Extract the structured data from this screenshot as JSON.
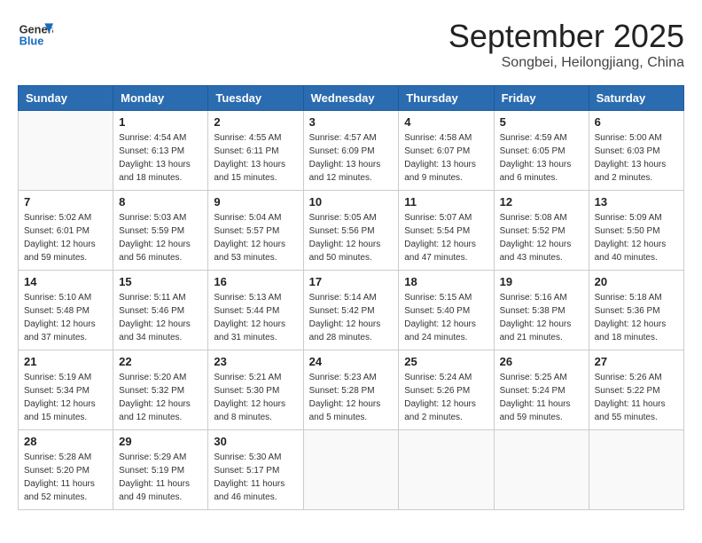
{
  "header": {
    "logo_general": "General",
    "logo_blue": "Blue",
    "month": "September 2025",
    "location": "Songbei, Heilongjiang, China"
  },
  "weekdays": [
    "Sunday",
    "Monday",
    "Tuesday",
    "Wednesday",
    "Thursday",
    "Friday",
    "Saturday"
  ],
  "weeks": [
    [
      {
        "day": "",
        "info": ""
      },
      {
        "day": "1",
        "info": "Sunrise: 4:54 AM\nSunset: 6:13 PM\nDaylight: 13 hours\nand 18 minutes."
      },
      {
        "day": "2",
        "info": "Sunrise: 4:55 AM\nSunset: 6:11 PM\nDaylight: 13 hours\nand 15 minutes."
      },
      {
        "day": "3",
        "info": "Sunrise: 4:57 AM\nSunset: 6:09 PM\nDaylight: 13 hours\nand 12 minutes."
      },
      {
        "day": "4",
        "info": "Sunrise: 4:58 AM\nSunset: 6:07 PM\nDaylight: 13 hours\nand 9 minutes."
      },
      {
        "day": "5",
        "info": "Sunrise: 4:59 AM\nSunset: 6:05 PM\nDaylight: 13 hours\nand 6 minutes."
      },
      {
        "day": "6",
        "info": "Sunrise: 5:00 AM\nSunset: 6:03 PM\nDaylight: 13 hours\nand 2 minutes."
      }
    ],
    [
      {
        "day": "7",
        "info": "Sunrise: 5:02 AM\nSunset: 6:01 PM\nDaylight: 12 hours\nand 59 minutes."
      },
      {
        "day": "8",
        "info": "Sunrise: 5:03 AM\nSunset: 5:59 PM\nDaylight: 12 hours\nand 56 minutes."
      },
      {
        "day": "9",
        "info": "Sunrise: 5:04 AM\nSunset: 5:57 PM\nDaylight: 12 hours\nand 53 minutes."
      },
      {
        "day": "10",
        "info": "Sunrise: 5:05 AM\nSunset: 5:56 PM\nDaylight: 12 hours\nand 50 minutes."
      },
      {
        "day": "11",
        "info": "Sunrise: 5:07 AM\nSunset: 5:54 PM\nDaylight: 12 hours\nand 47 minutes."
      },
      {
        "day": "12",
        "info": "Sunrise: 5:08 AM\nSunset: 5:52 PM\nDaylight: 12 hours\nand 43 minutes."
      },
      {
        "day": "13",
        "info": "Sunrise: 5:09 AM\nSunset: 5:50 PM\nDaylight: 12 hours\nand 40 minutes."
      }
    ],
    [
      {
        "day": "14",
        "info": "Sunrise: 5:10 AM\nSunset: 5:48 PM\nDaylight: 12 hours\nand 37 minutes."
      },
      {
        "day": "15",
        "info": "Sunrise: 5:11 AM\nSunset: 5:46 PM\nDaylight: 12 hours\nand 34 minutes."
      },
      {
        "day": "16",
        "info": "Sunrise: 5:13 AM\nSunset: 5:44 PM\nDaylight: 12 hours\nand 31 minutes."
      },
      {
        "day": "17",
        "info": "Sunrise: 5:14 AM\nSunset: 5:42 PM\nDaylight: 12 hours\nand 28 minutes."
      },
      {
        "day": "18",
        "info": "Sunrise: 5:15 AM\nSunset: 5:40 PM\nDaylight: 12 hours\nand 24 minutes."
      },
      {
        "day": "19",
        "info": "Sunrise: 5:16 AM\nSunset: 5:38 PM\nDaylight: 12 hours\nand 21 minutes."
      },
      {
        "day": "20",
        "info": "Sunrise: 5:18 AM\nSunset: 5:36 PM\nDaylight: 12 hours\nand 18 minutes."
      }
    ],
    [
      {
        "day": "21",
        "info": "Sunrise: 5:19 AM\nSunset: 5:34 PM\nDaylight: 12 hours\nand 15 minutes."
      },
      {
        "day": "22",
        "info": "Sunrise: 5:20 AM\nSunset: 5:32 PM\nDaylight: 12 hours\nand 12 minutes."
      },
      {
        "day": "23",
        "info": "Sunrise: 5:21 AM\nSunset: 5:30 PM\nDaylight: 12 hours\nand 8 minutes."
      },
      {
        "day": "24",
        "info": "Sunrise: 5:23 AM\nSunset: 5:28 PM\nDaylight: 12 hours\nand 5 minutes."
      },
      {
        "day": "25",
        "info": "Sunrise: 5:24 AM\nSunset: 5:26 PM\nDaylight: 12 hours\nand 2 minutes."
      },
      {
        "day": "26",
        "info": "Sunrise: 5:25 AM\nSunset: 5:24 PM\nDaylight: 11 hours\nand 59 minutes."
      },
      {
        "day": "27",
        "info": "Sunrise: 5:26 AM\nSunset: 5:22 PM\nDaylight: 11 hours\nand 55 minutes."
      }
    ],
    [
      {
        "day": "28",
        "info": "Sunrise: 5:28 AM\nSunset: 5:20 PM\nDaylight: 11 hours\nand 52 minutes."
      },
      {
        "day": "29",
        "info": "Sunrise: 5:29 AM\nSunset: 5:19 PM\nDaylight: 11 hours\nand 49 minutes."
      },
      {
        "day": "30",
        "info": "Sunrise: 5:30 AM\nSunset: 5:17 PM\nDaylight: 11 hours\nand 46 minutes."
      },
      {
        "day": "",
        "info": ""
      },
      {
        "day": "",
        "info": ""
      },
      {
        "day": "",
        "info": ""
      },
      {
        "day": "",
        "info": ""
      }
    ]
  ]
}
